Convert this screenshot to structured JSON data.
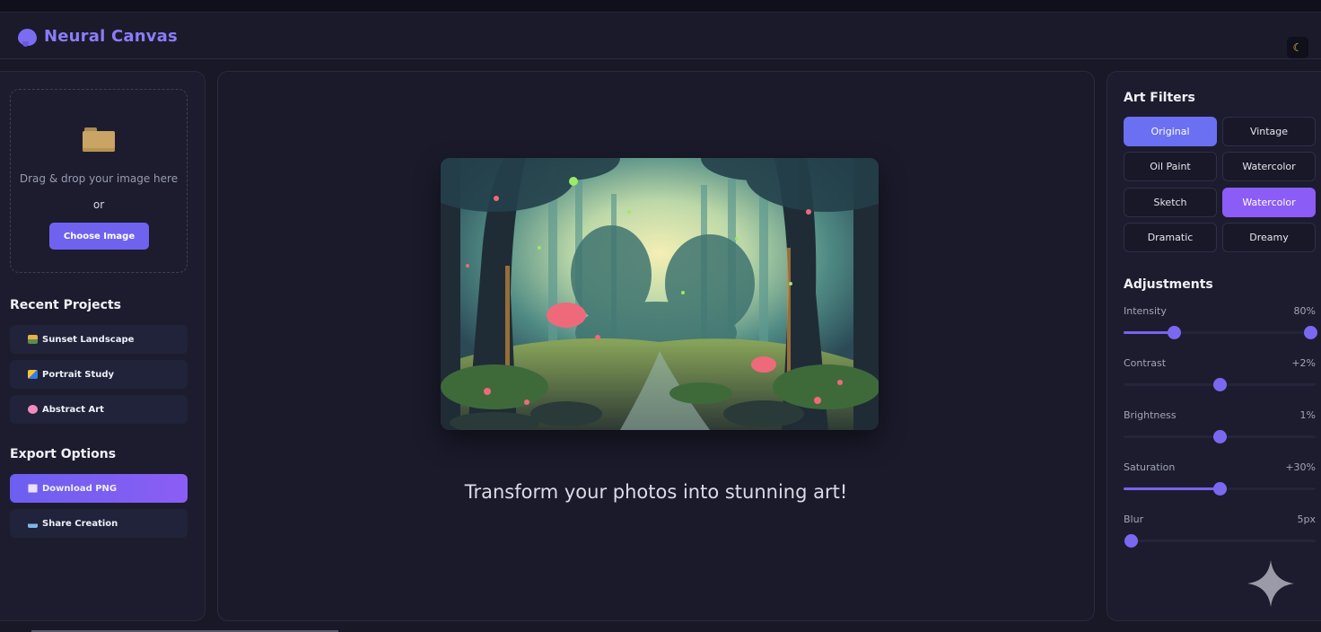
{
  "app": {
    "title": "Neural Canvas",
    "theme_toggle_icon": "moon-icon"
  },
  "upload": {
    "icon": "folder-icon",
    "drop_text": "Drag & drop your image here",
    "or_text": "or",
    "choose_label": "Choose Image"
  },
  "recent": {
    "title": "Recent Projects",
    "items": [
      {
        "label": "Sunset Landscape",
        "icon": "landscape-icon"
      },
      {
        "label": "Portrait Study",
        "icon": "portrait-icon"
      },
      {
        "label": "Abstract Art",
        "icon": "flower-icon"
      }
    ]
  },
  "export": {
    "title": "Export Options",
    "items": [
      {
        "label": "Download PNG",
        "icon": "download-icon",
        "active": true
      },
      {
        "label": "Share Creation",
        "icon": "share-icon",
        "active": false
      }
    ]
  },
  "canvas": {
    "image_subject": "forest-painting",
    "tagline": "Transform your photos into stunning art!"
  },
  "filters": {
    "title": "Art Filters",
    "items": [
      {
        "label": "Original",
        "selected": "primary"
      },
      {
        "label": "Vintage",
        "selected": "none"
      },
      {
        "label": "Oil Paint",
        "selected": "none"
      },
      {
        "label": "Watercolor",
        "selected": "none"
      },
      {
        "label": "Sketch",
        "selected": "none"
      },
      {
        "label": "Watercolor",
        "selected": "secondary"
      },
      {
        "label": "Dramatic",
        "selected": "none"
      },
      {
        "label": "Dreamy",
        "selected": "none"
      }
    ]
  },
  "adjustments": {
    "title": "Adjustments",
    "items": [
      {
        "label": "Intensity",
        "value": "80%",
        "level": 0.26,
        "filled": true
      },
      {
        "label": "Contrast",
        "value": "+2%",
        "level": 0.5,
        "filled": false
      },
      {
        "label": "Brightness",
        "value": "1%",
        "level": 0.5,
        "filled": false
      },
      {
        "label": "Saturation",
        "value": "+30%",
        "level": 0.5,
        "filled": true
      },
      {
        "label": "Blur",
        "value": "5px",
        "level": 0.0,
        "filled": false
      }
    ]
  },
  "colors": {
    "accent": "#6f62ee",
    "accent_purple": "#8b5cf6",
    "background": "#181827",
    "panel": "#1c1c2e"
  }
}
